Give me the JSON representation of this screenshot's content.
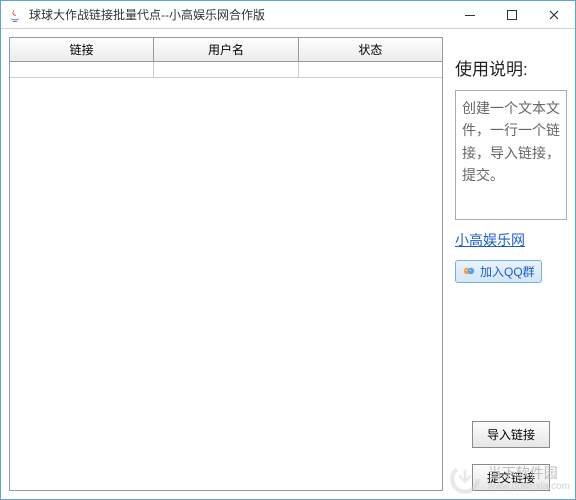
{
  "window": {
    "title": "球球大作战链接批量代点--小高娱乐网合作版",
    "minimize_title": "Minimize",
    "maximize_title": "Maximize",
    "close_title": "Close"
  },
  "table": {
    "columns": [
      "链接",
      "用户名",
      "状态"
    ],
    "rows": [
      [
        "",
        "",
        ""
      ]
    ]
  },
  "sidebar": {
    "heading": "使用说明:",
    "instructions": "创建一个文本文件，一行一个链接，导入链接，提交。",
    "link_label": "小高娱乐网",
    "qq_label": "加入QQ群",
    "import_label": "导入链接",
    "submit_label": "提交链接"
  },
  "watermark": {
    "name": "当下软件园",
    "url": "www.downxia.com"
  }
}
